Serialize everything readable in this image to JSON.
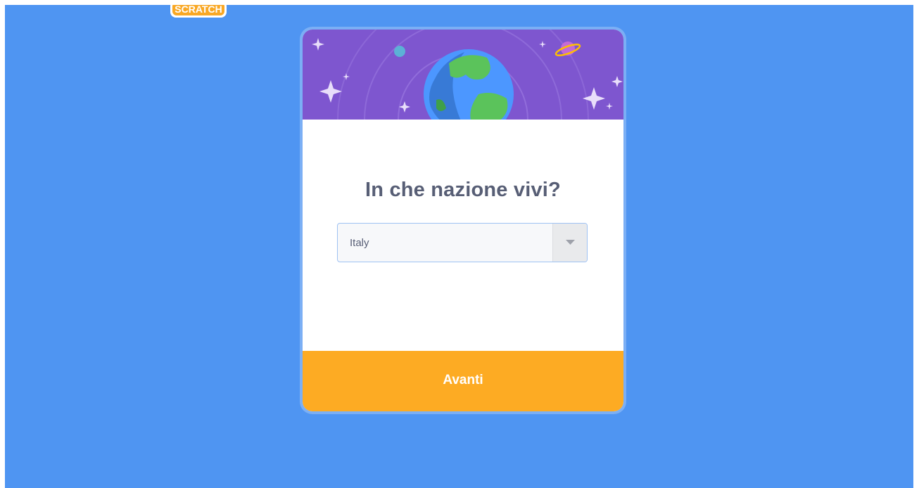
{
  "logo": {
    "text": "SCRATCH"
  },
  "dialog": {
    "title": "In che nazione vivi?",
    "country_select": {
      "value": "Italy",
      "icon": "chevron-down-icon"
    },
    "next_button_label": "Avanti"
  },
  "colors": {
    "page_background": "#4f95f2",
    "banner_background": "#7e56cf",
    "button_background": "#fdab23",
    "title_text": "#575e75",
    "logo_orange": "#f9a825"
  }
}
